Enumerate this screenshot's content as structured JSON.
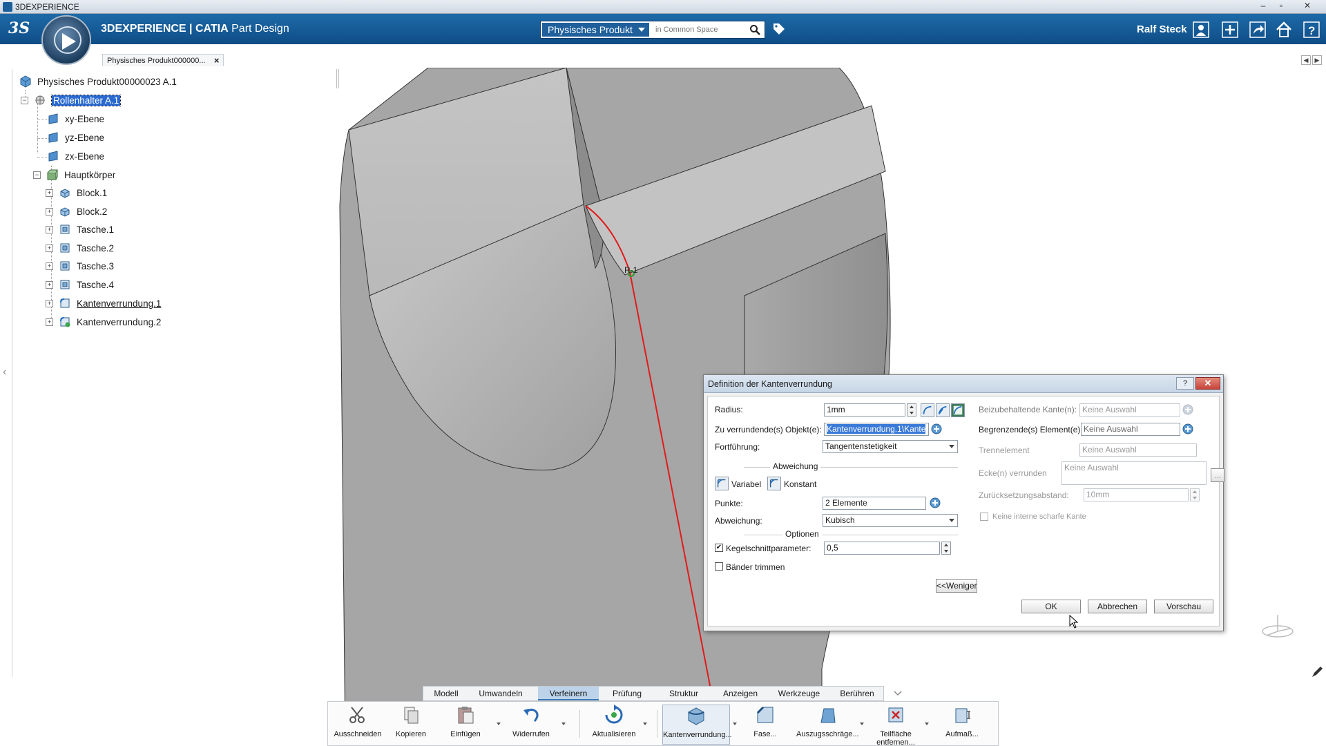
{
  "window": {
    "title": "3DEXPERIENCE",
    "controls": [
      "–",
      "▫",
      "✕"
    ]
  },
  "header": {
    "brand": "3DEXPERIENCE | ",
    "product": "CATIA",
    "app": " Part Design",
    "search_scope": "Physisches Produkt",
    "search_placeholder": "in Common Space",
    "user": "Ralf Steck"
  },
  "document_tab": {
    "label": "Physisches Produkt000000...",
    "close": "×"
  },
  "tree": {
    "root": "Physisches Produkt00000023 A.1",
    "part": "Rollenhalter A.1",
    "planes": [
      "xy-Ebene",
      "yz-Ebene",
      "zx-Ebene"
    ],
    "body": "Hauptkörper",
    "features": [
      "Block.1",
      "Block.2",
      "Tasche.1",
      "Tasche.2",
      "Tasche.3",
      "Tasche.4",
      "Kantenverrundung.1",
      "Kantenverrundung.2"
    ]
  },
  "viewport": {
    "point_label": "R-1"
  },
  "dialog": {
    "title": "Definition der Kantenverrundung",
    "help": "?",
    "close": "✕",
    "radius_label": "Radius:",
    "radius_value": "1mm",
    "objects_label": "Zu verrundende(s) Objekt(e):",
    "objects_value": "Kantenverrundung.1\\Kante",
    "propagation_label": "Fortführung:",
    "propagation_value": "Tangentenstetigkeit",
    "variation_title": "Abweichung",
    "variable_label": "Variabel",
    "constant_label": "Konstant",
    "points_label": "Punkte:",
    "points_value": "2 Elemente",
    "variation_label": "Abweichung:",
    "variation_value": "Kubisch",
    "options_title": "Optionen",
    "conic_label": "Kegelschnittparameter:",
    "conic_value": "0,5",
    "conic_checked": "✔",
    "trim_label": "Bänder trimmen",
    "less_button": "<<Weniger",
    "keep_edges_label": "Beizubehaltende Kante(n):",
    "keep_edges_value": "Keine Auswahl",
    "limit_label": "Begrenzende(s) Element(e):",
    "limit_value": "Keine Auswahl",
    "separator_label": "Trennelement",
    "separator_value": "Keine Auswahl",
    "corners_label": "Ecke(n) verrunden",
    "corners_value": "Keine Auswahl",
    "corners_more": "...",
    "setback_label": "Zurücksetzungsabstand:",
    "setback_value": "10mm",
    "no_internal_label": "Keine interne scharfe Kante",
    "ok": "OK",
    "cancel": "Abbrechen",
    "preview": "Vorschau"
  },
  "section_tabs": [
    "Modell",
    "Umwandeln",
    "Verfeinern",
    "Prüfung",
    "Struktur",
    "Anzeigen",
    "Werkzeuge",
    "Berühren"
  ],
  "active_section": "Verfeinern",
  "toolbar": {
    "cut": "Ausschneiden",
    "copy": "Kopieren",
    "paste": "Einfügen",
    "undo": "Widerrufen",
    "update": "Aktualisieren",
    "edge_fillet": "Kantenverrundung...",
    "chamfer": "Fase...",
    "draft": "Auszugsschräge...",
    "remove_face_1": "Teilfläche",
    "remove_face_2": "entfernen...",
    "thickness": "Aufmaß..."
  },
  "colors": {
    "header_blue": "#135a96",
    "selection_blue": "#2a6ad0",
    "edge_red": "#e21a1a",
    "part_gray": "#a8a8a8"
  }
}
